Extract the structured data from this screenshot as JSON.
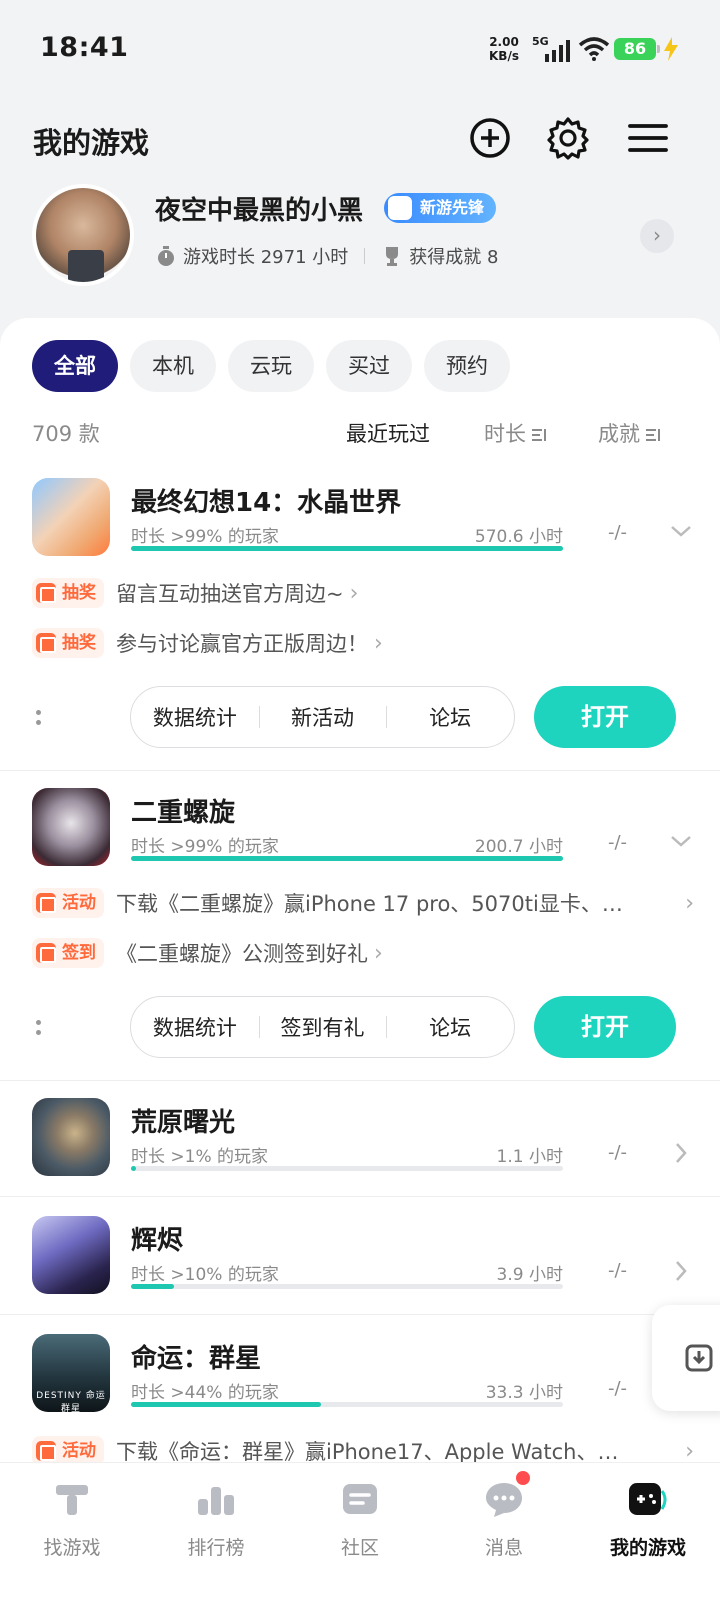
{
  "status": {
    "time": "18:41",
    "rate_top": "2.00",
    "rate_bottom": "KB/s",
    "network": "5G",
    "battery": "86"
  },
  "header": {
    "title": "我的游戏"
  },
  "profile": {
    "username": "夜空中最黑的小黑",
    "badge": "新游先锋",
    "playtime": "游戏时长 2971 小时",
    "achievements": "获得成就 8"
  },
  "filters": [
    "全部",
    "本机",
    "云玩",
    "买过",
    "预约"
  ],
  "sort": {
    "count": "709 款",
    "recent": "最近玩过",
    "duration": "时长",
    "achievements": "成就"
  },
  "games": [
    {
      "name": "最终幻想14：水晶世界",
      "percentile": "时长 >99% 的玩家",
      "hours": "570.6 小时",
      "progress": 1.0,
      "achievements": "-/-",
      "promos": [
        {
          "tag": "抽奖",
          "text": "留言互动抽送官方周边~"
        },
        {
          "tag": "抽奖",
          "text": "参与讨论赢官方正版周边！"
        }
      ],
      "actions": [
        "数据统计",
        "新活动",
        "论坛"
      ],
      "open": "打开"
    },
    {
      "name": "二重螺旋",
      "percentile": "时长 >99% 的玩家",
      "hours": "200.7 小时",
      "progress": 1.0,
      "achievements": "-/-",
      "promos": [
        {
          "tag": "活动",
          "text": "下载《二重螺旋》赢iPhone 17 pro、5070ti显卡、…"
        },
        {
          "tag": "签到",
          "text": "《二重螺旋》公测签到好礼"
        }
      ],
      "actions": [
        "数据统计",
        "签到有礼",
        "论坛"
      ],
      "open": "打开"
    },
    {
      "name": "荒原曙光",
      "percentile": "时长 >1% 的玩家",
      "hours": "1.1 小时",
      "progress": 0.01,
      "achievements": "-/-"
    },
    {
      "name": "辉烬",
      "percentile": "时长 >10% 的玩家",
      "hours": "3.9 小时",
      "progress": 0.1,
      "achievements": "-/-"
    },
    {
      "name": "命运：群星",
      "percentile": "时长 >44% 的玩家",
      "hours": "33.3 小时",
      "progress": 0.44,
      "achievements": "-/-",
      "icon_text": "DESTINY 命运 群星",
      "promos": [
        {
          "tag": "活动",
          "text": "下载《命运：群星》赢iPhone17、Apple Watch、…"
        }
      ]
    }
  ],
  "nav": [
    "找游戏",
    "排行榜",
    "社区",
    "消息",
    "我的游戏"
  ],
  "colors": {
    "accent": "#1ed4be",
    "chip_active": "#1f1c7a",
    "promo": "#ff6a3d",
    "badge": "#3a8bff"
  }
}
